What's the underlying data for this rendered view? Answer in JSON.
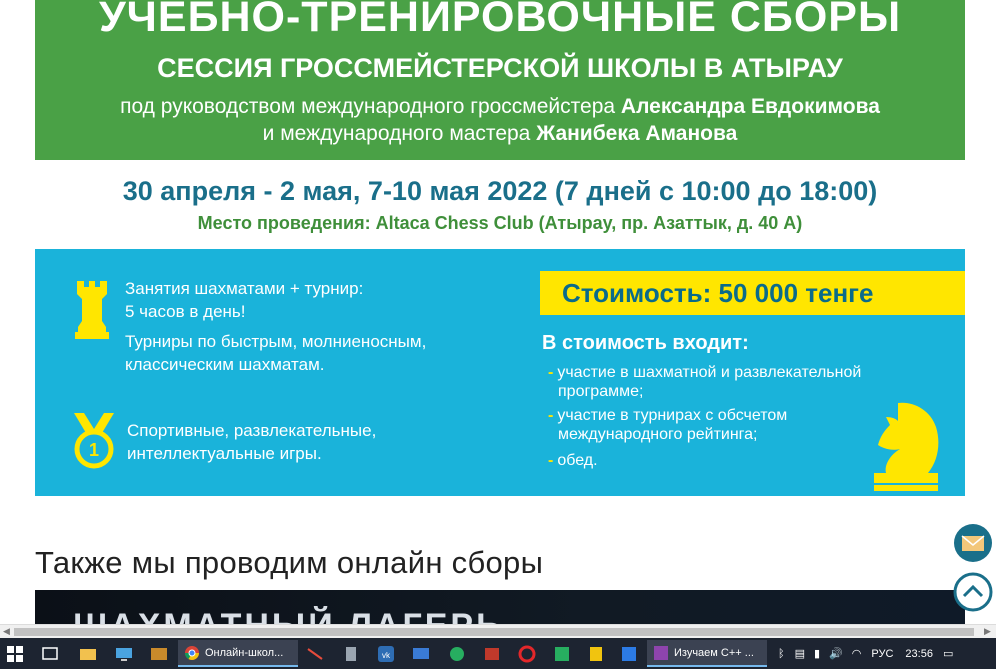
{
  "banner": {
    "title": "УЧЕБНО-ТРЕНИРОВОЧНЫЕ СБОРЫ",
    "subtitle": "СЕССИЯ ГРОССМЕЙСТЕРСКОЙ ШКОЛЫ В АТЫРАУ",
    "line1_prefix": "под руководством международного гроссмейстера ",
    "line1_name": "Александра Евдокимова",
    "line2_prefix": "и международного мастера ",
    "line2_name": "Жанибека Аманова"
  },
  "dates": "30 апреля - 2 мая, 7-10 мая 2022 (7 дней с 10:00 до 18:00)",
  "venue": "Место проведения: Altaca Chess Club (Атырау, пр. Азаттык, д. 40 А)",
  "features": {
    "f1": "Занятия шахматами + турнир:",
    "f2": "5 часов в день!",
    "f3": "Турниры по быстрым, молниеносным,",
    "f4": "классическим шахматам.",
    "f5": "Спортивные, развлекательные,",
    "f6": "интеллектуальные игры."
  },
  "price": "Стоимость: 50 000 тенге",
  "includes_title": "В стоимость входит:",
  "includes": {
    "i1a": "участие в шахматной и развлекательной",
    "i1b": "программе;",
    "i2a": "участие в турнирах с обсчетом",
    "i2b": "международного рейтинга;",
    "i3a": "обед."
  },
  "online_title": "Также мы проводим онлайн сборы",
  "dark_banner_text": "ШАХМАТНЫЙ ЛАГЕРЬ",
  "colors": {
    "green": "#4aa146",
    "blue": "#1ab3da",
    "yellow": "#ffe600",
    "navy": "#1a6f8a"
  },
  "taskbar": {
    "chrome_tab": "Онлайн-школ...",
    "cpp_tab": "Изучаем C++ ...",
    "lang": "РУС",
    "time": "23:56"
  }
}
